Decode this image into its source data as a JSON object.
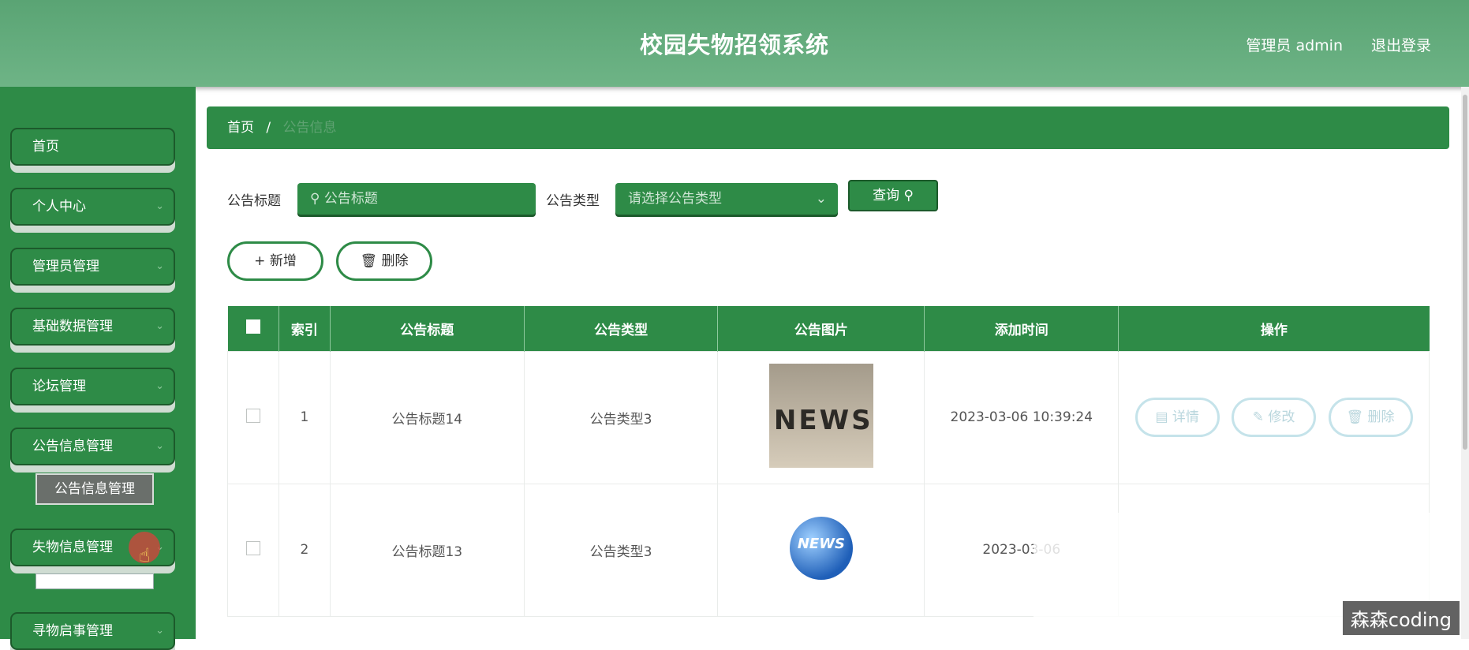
{
  "header": {
    "title": "校园失物招领系统",
    "user": "管理员 admin",
    "logout": "退出登录"
  },
  "sidebar": {
    "items": [
      {
        "label": "首页"
      },
      {
        "label": "个人中心"
      },
      {
        "label": "管理员管理"
      },
      {
        "label": "基础数据管理"
      },
      {
        "label": "论坛管理"
      },
      {
        "label": "公告信息管理"
      },
      {
        "label": "失物信息管理"
      },
      {
        "label": "寻物启事管理"
      }
    ],
    "submenu": "公告信息管理"
  },
  "breadcrumb": {
    "home": "首页",
    "sep": "/",
    "current": "公告信息"
  },
  "search": {
    "title_label": "公告标题",
    "title_placeholder": "公告标题",
    "type_label": "公告类型",
    "type_placeholder": "请选择公告类型",
    "query_button": "查询"
  },
  "actions": {
    "add": "新增",
    "delete": "删除"
  },
  "table": {
    "headers": [
      "索引",
      "公告标题",
      "公告类型",
      "公告图片",
      "添加时间",
      "操作"
    ],
    "rows": [
      {
        "index": "1",
        "title": "公告标题14",
        "type": "公告类型3",
        "time": "2023-03-06 10:39:24"
      },
      {
        "index": "2",
        "title": "公告标题13",
        "type": "公告类型3",
        "time": "2023-03-06"
      }
    ],
    "row_buttons": {
      "detail": "详情",
      "edit": "修改",
      "delete": "删除"
    }
  },
  "images": {
    "news1": "NEWS",
    "news2": "NEWS"
  },
  "watermark": "森森coding",
  "colors": {
    "primary": "#2e8b47",
    "header": "#5aa474",
    "border": "#1c5a2b"
  }
}
